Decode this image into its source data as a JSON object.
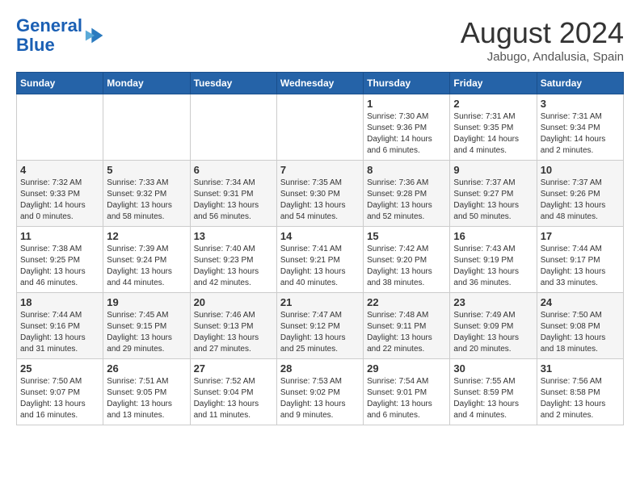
{
  "header": {
    "logo_line1": "General",
    "logo_line2": "Blue",
    "month_year": "August 2024",
    "location": "Jabugo, Andalusia, Spain"
  },
  "weekdays": [
    "Sunday",
    "Monday",
    "Tuesday",
    "Wednesday",
    "Thursday",
    "Friday",
    "Saturday"
  ],
  "weeks": [
    [
      {
        "day": "",
        "info": ""
      },
      {
        "day": "",
        "info": ""
      },
      {
        "day": "",
        "info": ""
      },
      {
        "day": "",
        "info": ""
      },
      {
        "day": "1",
        "info": "Sunrise: 7:30 AM\nSunset: 9:36 PM\nDaylight: 14 hours\nand 6 minutes."
      },
      {
        "day": "2",
        "info": "Sunrise: 7:31 AM\nSunset: 9:35 PM\nDaylight: 14 hours\nand 4 minutes."
      },
      {
        "day": "3",
        "info": "Sunrise: 7:31 AM\nSunset: 9:34 PM\nDaylight: 14 hours\nand 2 minutes."
      }
    ],
    [
      {
        "day": "4",
        "info": "Sunrise: 7:32 AM\nSunset: 9:33 PM\nDaylight: 14 hours\nand 0 minutes."
      },
      {
        "day": "5",
        "info": "Sunrise: 7:33 AM\nSunset: 9:32 PM\nDaylight: 13 hours\nand 58 minutes."
      },
      {
        "day": "6",
        "info": "Sunrise: 7:34 AM\nSunset: 9:31 PM\nDaylight: 13 hours\nand 56 minutes."
      },
      {
        "day": "7",
        "info": "Sunrise: 7:35 AM\nSunset: 9:30 PM\nDaylight: 13 hours\nand 54 minutes."
      },
      {
        "day": "8",
        "info": "Sunrise: 7:36 AM\nSunset: 9:28 PM\nDaylight: 13 hours\nand 52 minutes."
      },
      {
        "day": "9",
        "info": "Sunrise: 7:37 AM\nSunset: 9:27 PM\nDaylight: 13 hours\nand 50 minutes."
      },
      {
        "day": "10",
        "info": "Sunrise: 7:37 AM\nSunset: 9:26 PM\nDaylight: 13 hours\nand 48 minutes."
      }
    ],
    [
      {
        "day": "11",
        "info": "Sunrise: 7:38 AM\nSunset: 9:25 PM\nDaylight: 13 hours\nand 46 minutes."
      },
      {
        "day": "12",
        "info": "Sunrise: 7:39 AM\nSunset: 9:24 PM\nDaylight: 13 hours\nand 44 minutes."
      },
      {
        "day": "13",
        "info": "Sunrise: 7:40 AM\nSunset: 9:23 PM\nDaylight: 13 hours\nand 42 minutes."
      },
      {
        "day": "14",
        "info": "Sunrise: 7:41 AM\nSunset: 9:21 PM\nDaylight: 13 hours\nand 40 minutes."
      },
      {
        "day": "15",
        "info": "Sunrise: 7:42 AM\nSunset: 9:20 PM\nDaylight: 13 hours\nand 38 minutes."
      },
      {
        "day": "16",
        "info": "Sunrise: 7:43 AM\nSunset: 9:19 PM\nDaylight: 13 hours\nand 36 minutes."
      },
      {
        "day": "17",
        "info": "Sunrise: 7:44 AM\nSunset: 9:17 PM\nDaylight: 13 hours\nand 33 minutes."
      }
    ],
    [
      {
        "day": "18",
        "info": "Sunrise: 7:44 AM\nSunset: 9:16 PM\nDaylight: 13 hours\nand 31 minutes."
      },
      {
        "day": "19",
        "info": "Sunrise: 7:45 AM\nSunset: 9:15 PM\nDaylight: 13 hours\nand 29 minutes."
      },
      {
        "day": "20",
        "info": "Sunrise: 7:46 AM\nSunset: 9:13 PM\nDaylight: 13 hours\nand 27 minutes."
      },
      {
        "day": "21",
        "info": "Sunrise: 7:47 AM\nSunset: 9:12 PM\nDaylight: 13 hours\nand 25 minutes."
      },
      {
        "day": "22",
        "info": "Sunrise: 7:48 AM\nSunset: 9:11 PM\nDaylight: 13 hours\nand 22 minutes."
      },
      {
        "day": "23",
        "info": "Sunrise: 7:49 AM\nSunset: 9:09 PM\nDaylight: 13 hours\nand 20 minutes."
      },
      {
        "day": "24",
        "info": "Sunrise: 7:50 AM\nSunset: 9:08 PM\nDaylight: 13 hours\nand 18 minutes."
      }
    ],
    [
      {
        "day": "25",
        "info": "Sunrise: 7:50 AM\nSunset: 9:07 PM\nDaylight: 13 hours\nand 16 minutes."
      },
      {
        "day": "26",
        "info": "Sunrise: 7:51 AM\nSunset: 9:05 PM\nDaylight: 13 hours\nand 13 minutes."
      },
      {
        "day": "27",
        "info": "Sunrise: 7:52 AM\nSunset: 9:04 PM\nDaylight: 13 hours\nand 11 minutes."
      },
      {
        "day": "28",
        "info": "Sunrise: 7:53 AM\nSunset: 9:02 PM\nDaylight: 13 hours\nand 9 minutes."
      },
      {
        "day": "29",
        "info": "Sunrise: 7:54 AM\nSunset: 9:01 PM\nDaylight: 13 hours\nand 6 minutes."
      },
      {
        "day": "30",
        "info": "Sunrise: 7:55 AM\nSunset: 8:59 PM\nDaylight: 13 hours\nand 4 minutes."
      },
      {
        "day": "31",
        "info": "Sunrise: 7:56 AM\nSunset: 8:58 PM\nDaylight: 13 hours\nand 2 minutes."
      }
    ]
  ]
}
